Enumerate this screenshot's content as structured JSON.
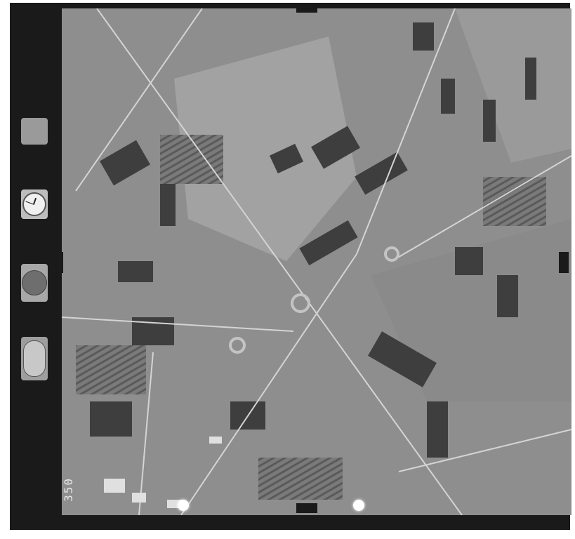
{
  "photo": {
    "frame_number": "350",
    "description_type": "aerial-photograph"
  },
  "colors": {
    "film_border": "#1a1a1a",
    "field_light": "#a6a6a6",
    "field_dark": "#3c3c3c",
    "road": "#d0d0d0"
  },
  "icons": [
    "altimeter-icon",
    "clock-icon",
    "level-icon",
    "bubble-level-icon"
  ]
}
